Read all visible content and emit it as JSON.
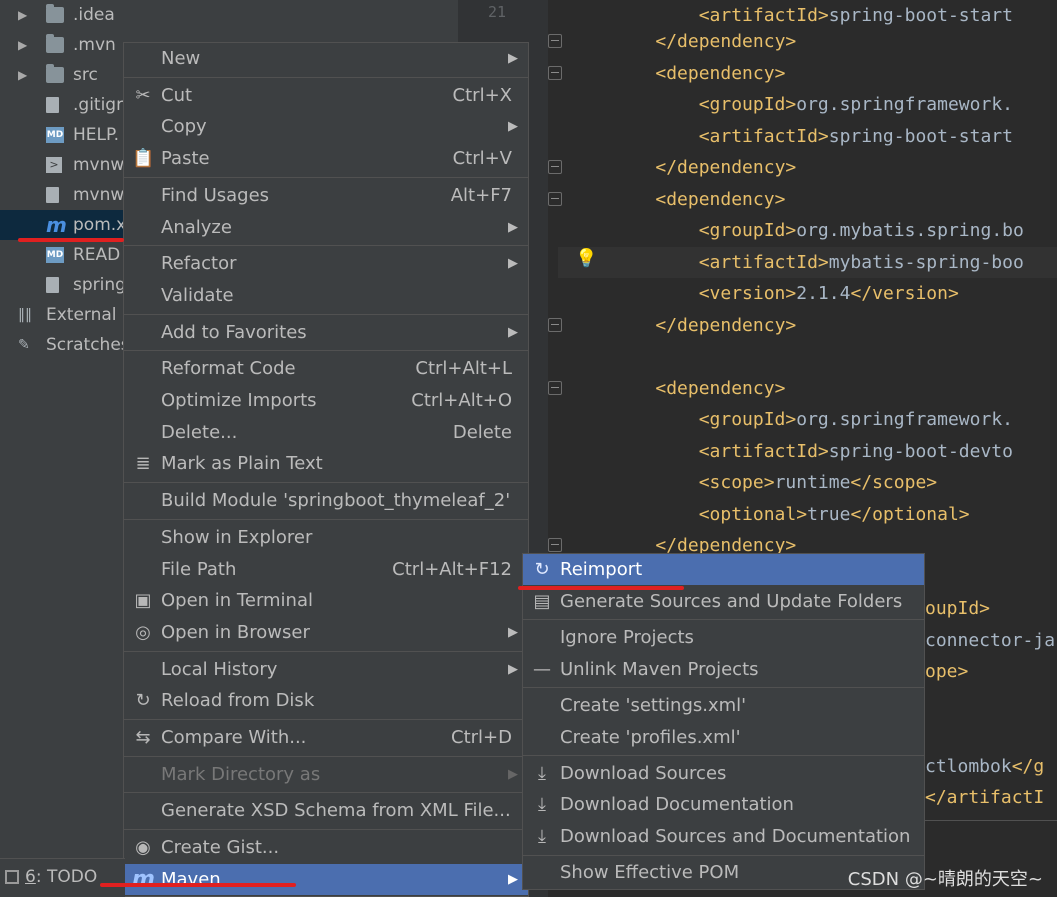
{
  "tree": {
    "items": [
      {
        "label": ".idea",
        "icon": "folder-icon"
      },
      {
        "label": ".mvn",
        "icon": "folder-icon"
      },
      {
        "label": "src",
        "icon": "folder-icon"
      },
      {
        "label": ".gitigr",
        "icon": "file-icon"
      },
      {
        "label": "HELP.",
        "icon": "markdown-icon"
      },
      {
        "label": "mvnw",
        "icon": "terminal-file-icon"
      },
      {
        "label": "mvnw",
        "icon": "file-icon"
      },
      {
        "label": "pom.x",
        "icon": "maven-icon"
      },
      {
        "label": "READ",
        "icon": "markdown-icon"
      },
      {
        "label": "spring",
        "icon": "file-icon"
      },
      {
        "label": "External l",
        "icon": "library-icon"
      },
      {
        "label": "Scratches",
        "icon": "scratch-icon"
      }
    ]
  },
  "editor": {
    "line_number": "21",
    "lines": [
      [
        {
          "t": "        "
        },
        {
          "c": "tag",
          "t": "<artifactId>"
        },
        {
          "c": "txt",
          "t": "spring-boot-start"
        }
      ],
      [
        {
          "t": "    "
        },
        {
          "c": "tag",
          "t": "</dependency>"
        }
      ],
      [
        {
          "t": "    "
        },
        {
          "c": "tag",
          "t": "<dependency>"
        }
      ],
      [
        {
          "t": "        "
        },
        {
          "c": "tag",
          "t": "<groupId>"
        },
        {
          "c": "txt",
          "t": "org.springframework."
        }
      ],
      [
        {
          "t": "        "
        },
        {
          "c": "tag",
          "t": "<artifactId>"
        },
        {
          "c": "txt",
          "t": "spring-boot-start"
        }
      ],
      [
        {
          "t": "    "
        },
        {
          "c": "tag",
          "t": "</dependency>"
        }
      ],
      [
        {
          "t": "    "
        },
        {
          "c": "tag",
          "t": "<dependency>"
        }
      ],
      [
        {
          "t": "        "
        },
        {
          "c": "tag",
          "t": "<groupId>"
        },
        {
          "c": "txt",
          "t": "org.mybatis.spring.bo"
        }
      ],
      [
        {
          "t": "        "
        },
        {
          "c": "tag",
          "t": "<artifactId>"
        },
        {
          "c": "txt",
          "t": "mybatis-spring-boo"
        }
      ],
      [
        {
          "t": "        "
        },
        {
          "c": "tag",
          "t": "<version>"
        },
        {
          "c": "txt",
          "t": "2.1.4"
        },
        {
          "c": "tag",
          "t": "</version>"
        }
      ],
      [
        {
          "t": "    "
        },
        {
          "c": "tag",
          "t": "</dependency>"
        }
      ],
      [
        {
          "t": ""
        }
      ],
      [
        {
          "t": "    "
        },
        {
          "c": "tag",
          "t": "<dependency>"
        }
      ],
      [
        {
          "t": "        "
        },
        {
          "c": "tag",
          "t": "<groupId>"
        },
        {
          "c": "txt",
          "t": "org.springframework."
        }
      ],
      [
        {
          "t": "        "
        },
        {
          "c": "tag",
          "t": "<artifactId>"
        },
        {
          "c": "txt",
          "t": "spring-boot-devto"
        }
      ],
      [
        {
          "t": "        "
        },
        {
          "c": "tag",
          "t": "<scope>"
        },
        {
          "c": "txt",
          "t": "runtime"
        },
        {
          "c": "tag",
          "t": "</scope>"
        }
      ],
      [
        {
          "t": "        "
        },
        {
          "c": "tag",
          "t": "<optional>"
        },
        {
          "c": "txt",
          "t": "true"
        },
        {
          "c": "tag",
          "t": "</optional>"
        }
      ],
      [
        {
          "t": "    "
        },
        {
          "c": "tag",
          "t": "</dependency>"
        }
      ]
    ],
    "tail_lines": [
      [
        {
          "c": "tag",
          "t": "oupId>"
        }
      ],
      [
        {
          "c": "txt",
          "t": "connector-ja"
        }
      ],
      [
        {
          "c": "tag",
          "t": "ope>"
        }
      ],
      [
        {
          "t": ""
        }
      ],
      [
        {
          "t": ""
        }
      ],
      [
        {
          "c": "txt",
          "t": "ctlombok"
        },
        {
          "c": "tag",
          "t": "</g"
        }
      ],
      [
        {
          "c": "tag",
          "t": "</artifactI"
        }
      ]
    ]
  },
  "context_menu": {
    "items": [
      {
        "label": "New",
        "submenu": true
      },
      {
        "sep": true
      },
      {
        "label": "Cut",
        "shortcut": "Ctrl+X",
        "icon": "scissors-icon"
      },
      {
        "label": "Copy",
        "submenu": true
      },
      {
        "label": "Paste",
        "shortcut": "Ctrl+V",
        "icon": "clipboard-icon"
      },
      {
        "sep": true
      },
      {
        "label": "Find Usages",
        "shortcut": "Alt+F7"
      },
      {
        "label": "Analyze",
        "submenu": true
      },
      {
        "sep": true
      },
      {
        "label": "Refactor",
        "submenu": true
      },
      {
        "label": "Validate"
      },
      {
        "sep": true
      },
      {
        "label": "Add to Favorites",
        "submenu": true
      },
      {
        "sep": true
      },
      {
        "label": "Reformat Code",
        "shortcut": "Ctrl+Alt+L"
      },
      {
        "label": "Optimize Imports",
        "shortcut": "Ctrl+Alt+O"
      },
      {
        "label": "Delete...",
        "shortcut": "Delete"
      },
      {
        "label": "Mark as Plain Text",
        "icon": "plain-text-icon"
      },
      {
        "sep": true
      },
      {
        "label": "Build Module 'springboot_thymeleaf_2'"
      },
      {
        "sep": true
      },
      {
        "label": "Show in Explorer"
      },
      {
        "label": "File Path",
        "shortcut": "Ctrl+Alt+F12"
      },
      {
        "label": "Open in Terminal",
        "icon": "terminal-icon"
      },
      {
        "label": "Open in Browser",
        "submenu": true,
        "icon": "globe-icon"
      },
      {
        "sep": true
      },
      {
        "label": "Local History",
        "submenu": true
      },
      {
        "label": "Reload from Disk",
        "icon": "reload-icon"
      },
      {
        "sep": true
      },
      {
        "label": "Compare With...",
        "shortcut": "Ctrl+D",
        "icon": "compare-icon"
      },
      {
        "sep": true
      },
      {
        "label": "Mark Directory as",
        "submenu": true,
        "disabled": true
      },
      {
        "sep": true
      },
      {
        "label": "Generate XSD Schema from XML File..."
      },
      {
        "sep": true
      },
      {
        "label": "Create Gist...",
        "icon": "github-icon"
      },
      {
        "label": "Maven",
        "submenu": true,
        "icon": "maven-icon",
        "highlighted": true
      }
    ]
  },
  "maven_submenu": {
    "items": [
      {
        "label": "Reimport",
        "icon": "reimport-icon",
        "highlighted": true
      },
      {
        "label": "Generate Sources and Update Folders",
        "icon": "generate-sources-icon"
      },
      {
        "sep": true
      },
      {
        "label": "Ignore Projects"
      },
      {
        "label": "Unlink Maven Projects",
        "icon": "minus-icon"
      },
      {
        "sep": true
      },
      {
        "label": "Create 'settings.xml'"
      },
      {
        "label": "Create 'profiles.xml'"
      },
      {
        "sep": true
      },
      {
        "label": "Download Sources",
        "icon": "download-icon"
      },
      {
        "label": "Download Documentation",
        "icon": "download-icon"
      },
      {
        "label": "Download Sources and Documentation",
        "icon": "download-icon"
      },
      {
        "sep": true
      },
      {
        "label": "Show Effective POM"
      }
    ]
  },
  "bottom_bar": {
    "todo_number": "6",
    "todo_label": ": TODO"
  },
  "watermark": "CSDN @~晴朗的天空~",
  "colors": {
    "highlight": "#4b6eaf",
    "tag": "#e8bf6a",
    "text": "#a9b7c6",
    "underline": "#e02020"
  }
}
